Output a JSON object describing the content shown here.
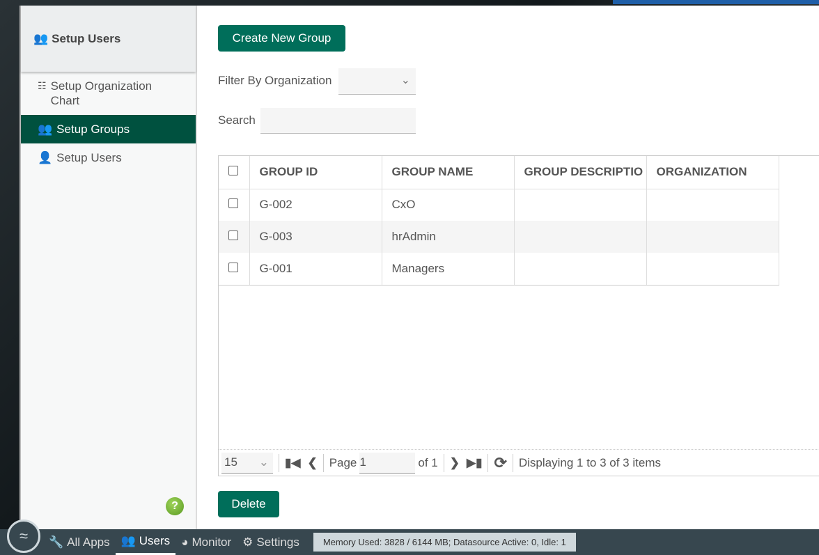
{
  "sidebar": {
    "header": "Setup Users",
    "items": [
      {
        "label": "Setup Organization Chart",
        "icon": "sitemap-icon"
      },
      {
        "label": "Setup Groups",
        "icon": "users-icon",
        "active": true
      },
      {
        "label": "Setup Users",
        "icon": "user-icon"
      }
    ],
    "help": "?"
  },
  "main": {
    "create_button": "Create New Group",
    "filter_label": "Filter By Organization",
    "filter_value": "",
    "search_label": "Search",
    "search_value": "",
    "columns": [
      "GROUP ID",
      "GROUP NAME",
      "GROUP DESCRIPTIO",
      "ORGANIZATION"
    ],
    "rows": [
      {
        "id": "G-002",
        "name": "CxO",
        "description": "",
        "organization": ""
      },
      {
        "id": "G-003",
        "name": "hrAdmin",
        "description": "",
        "organization": ""
      },
      {
        "id": "G-001",
        "name": "Managers",
        "description": "",
        "organization": ""
      }
    ],
    "pager": {
      "page_size": "15",
      "page_label": "Page",
      "page": "1",
      "of_label": "of 1",
      "display": "Displaying 1 to 3 of 3 items"
    },
    "delete_button": "Delete"
  },
  "taskbar": {
    "items": [
      {
        "label": "All Apps",
        "icon": "wrench-icon"
      },
      {
        "label": "Users",
        "icon": "users-icon",
        "active": true
      },
      {
        "label": "Monitor",
        "icon": "gauge-icon"
      },
      {
        "label": "Settings",
        "icon": "cogs-icon"
      }
    ],
    "status": "Memory Used: 3828 / 6144 MB; Datasource Active: 0, Idle: 1"
  },
  "colors": {
    "accent": "#006e5a",
    "active_nav": "#00513f",
    "taskbar": "#37474f"
  }
}
